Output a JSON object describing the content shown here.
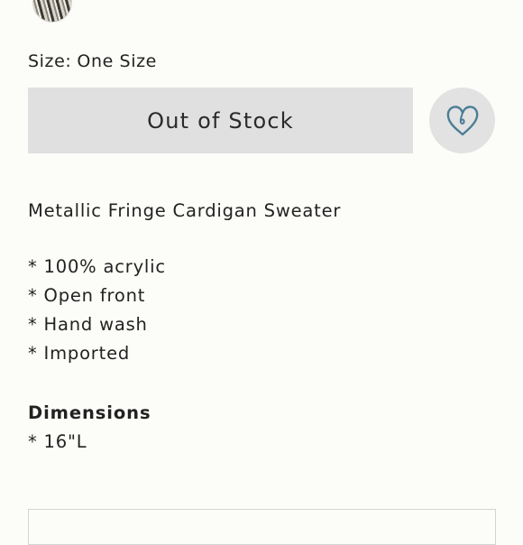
{
  "product": {
    "size_label": "Size:",
    "size_value": "One Size",
    "stock_button_label": "Out of Stock",
    "wishlist_icon": "heart-outline-icon"
  },
  "description": {
    "title": "Metallic Fringe Cardigan Sweater",
    "features": [
      "* 100% acrylic",
      "* Open front",
      "* Hand wash",
      "* Imported"
    ],
    "dimensions_heading": "Dimensions",
    "dimensions": [
      "* 16\"L"
    ]
  },
  "colors": {
    "background": "#fcfdf8",
    "button_gray": "#e0e0e0",
    "heart_stroke": "#4a7d96",
    "text": "#222222"
  }
}
